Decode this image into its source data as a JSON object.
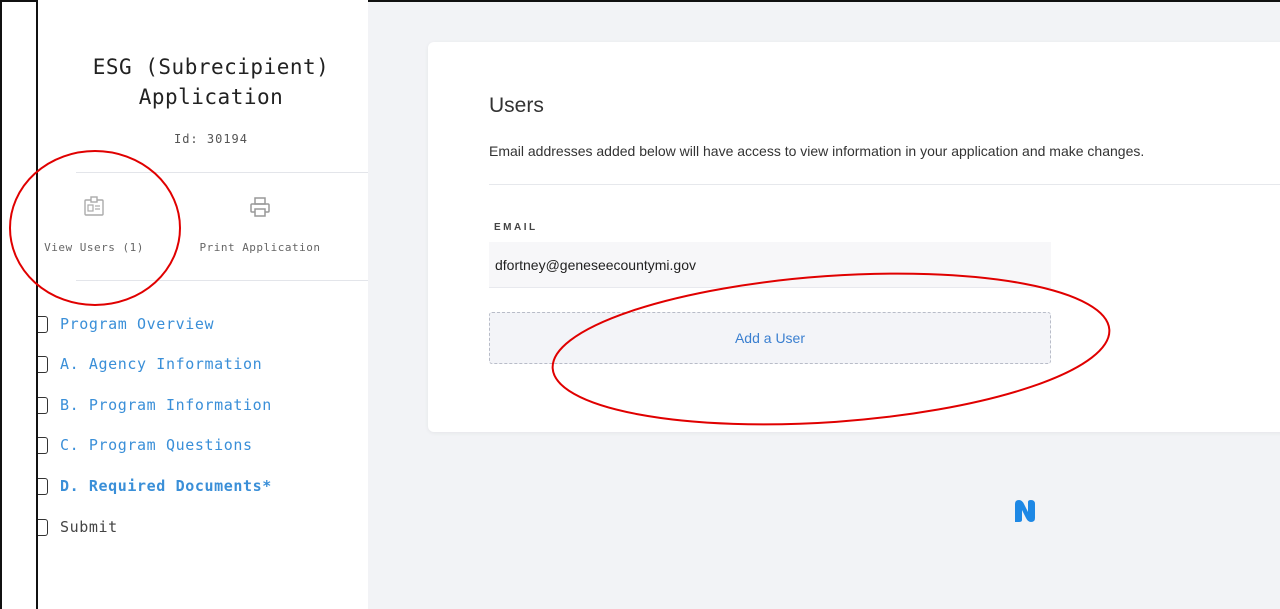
{
  "sidebar": {
    "title_line1": "ESG (Subrecipient)",
    "title_line2": "Application",
    "id_text": "Id: 30194",
    "actions": [
      {
        "label": "View Users (1)",
        "icon": "id-card-icon"
      },
      {
        "label": "Print Application",
        "icon": "printer-icon"
      }
    ],
    "nav": [
      {
        "label": "Program Overview"
      },
      {
        "label": "A. Agency Information"
      },
      {
        "label": "B. Program Information"
      },
      {
        "label": "C. Program Questions"
      },
      {
        "label": "D. Required Documents*"
      },
      {
        "label": "Submit"
      }
    ]
  },
  "users_card": {
    "title": "Users",
    "description": "Email addresses added below will have access to view information in your application and make changes.",
    "column_header": "EMAIL",
    "emails": [
      "dfortney@geneseecountymi.gov"
    ],
    "add_button": "Add a User"
  },
  "colors": {
    "link_blue": "#3a8fd8",
    "annotation_red": "#e00000",
    "main_bg": "#f2f3f6",
    "logo_blue": "#1e88e5"
  },
  "icons": [
    "id-card-icon",
    "printer-icon",
    "checkbox-icon",
    "brand-logo-icon"
  ]
}
